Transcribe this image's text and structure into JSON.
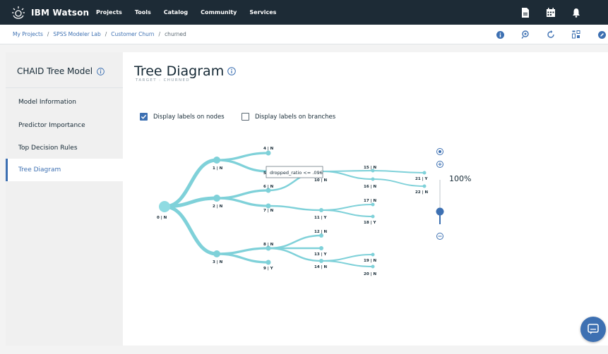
{
  "topbar": {
    "brand": "IBM Watson",
    "nav": [
      "Projects",
      "Tools",
      "Catalog",
      "Community",
      "Services"
    ],
    "icons": [
      "document-icon",
      "calendar-icon",
      "bell-icon"
    ]
  },
  "breadcrumb": {
    "items": [
      "My Projects",
      "SPSS Modeler Lab",
      "Customer Churn"
    ],
    "current": "churned",
    "separator": "/",
    "icons": [
      "info-icon",
      "flow-icon",
      "refresh-icon",
      "grid-icon",
      "edit-icon"
    ]
  },
  "sidebar": {
    "title": "CHAID Tree Model",
    "items": [
      {
        "label": "Model Information",
        "active": false
      },
      {
        "label": "Predictor Importance",
        "active": false
      },
      {
        "label": "Top Decision Rules",
        "active": false
      },
      {
        "label": "Tree Diagram",
        "active": true
      }
    ]
  },
  "main": {
    "title": "Tree Diagram",
    "subtitle": "TARGET : CHURNED",
    "options": {
      "labels_on_nodes": {
        "label": "Display labels on nodes",
        "checked": true
      },
      "labels_on_branches": {
        "label": "Display labels on branches",
        "checked": false
      }
    },
    "zoom": "100%",
    "tooltip": "dropped_ratio <= .096",
    "nodes": [
      {
        "id": "0",
        "label": "0 | N"
      },
      {
        "id": "1",
        "label": "1 | N"
      },
      {
        "id": "2",
        "label": "2 | N"
      },
      {
        "id": "3",
        "label": "3 | N"
      },
      {
        "id": "4",
        "label": "4 | N"
      },
      {
        "id": "5",
        "label": "5"
      },
      {
        "id": "6",
        "label": "6 | N"
      },
      {
        "id": "7",
        "label": "7 | N"
      },
      {
        "id": "8",
        "label": "8 | N"
      },
      {
        "id": "9",
        "label": "9 | Y"
      },
      {
        "id": "10",
        "label": "10 | N"
      },
      {
        "id": "11",
        "label": "11 | Y"
      },
      {
        "id": "12",
        "label": "12 | N"
      },
      {
        "id": "13",
        "label": "13 | Y"
      },
      {
        "id": "14",
        "label": "14 | N"
      },
      {
        "id": "15",
        "label": "15 | N"
      },
      {
        "id": "16",
        "label": "16 | N"
      },
      {
        "id": "17",
        "label": "17 | N"
      },
      {
        "id": "18",
        "label": "18 | Y"
      },
      {
        "id": "19",
        "label": "19 | N"
      },
      {
        "id": "20",
        "label": "20 | N"
      },
      {
        "id": "21",
        "label": "21 | Y"
      },
      {
        "id": "22",
        "label": "22 | N"
      }
    ],
    "edges": [
      [
        "0",
        "1"
      ],
      [
        "0",
        "2"
      ],
      [
        "0",
        "3"
      ],
      [
        "1",
        "4"
      ],
      [
        "1",
        "5"
      ],
      [
        "2",
        "6"
      ],
      [
        "2",
        "7"
      ],
      [
        "3",
        "8"
      ],
      [
        "3",
        "9"
      ],
      [
        "5",
        "10"
      ],
      [
        "6",
        "10"
      ],
      [
        "7",
        "11"
      ],
      [
        "8",
        "12"
      ],
      [
        "8",
        "13"
      ],
      [
        "8",
        "14"
      ],
      [
        "10",
        "15"
      ],
      [
        "10",
        "16"
      ],
      [
        "11",
        "17"
      ],
      [
        "11",
        "18"
      ],
      [
        "14",
        "19"
      ],
      [
        "14",
        "20"
      ],
      [
        "15",
        "21"
      ],
      [
        "16",
        "22"
      ]
    ]
  },
  "colors": {
    "edge": "#7fd1d9",
    "node": "#7fd1d9",
    "node_root": "#8fdbe2",
    "accent": "#3d70b2",
    "topbar": "#1d2b36"
  }
}
